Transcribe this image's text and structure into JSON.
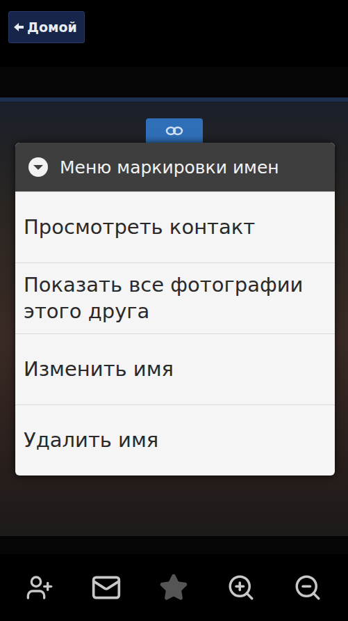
{
  "top_bar": {
    "back_button": "Домой"
  },
  "dialog": {
    "title": "Меню маркировки имен",
    "items": [
      "Просмотреть контакт",
      "Показать все фотографии этого друга",
      "Изменить имя",
      "Удалить имя"
    ]
  }
}
